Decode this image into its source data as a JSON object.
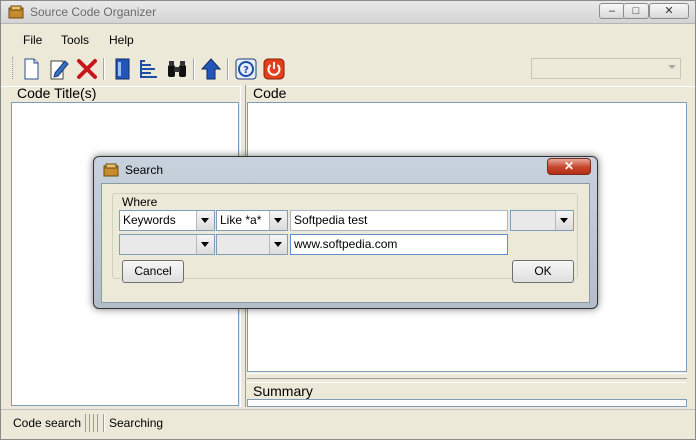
{
  "window": {
    "title": "Source Code Organizer",
    "controls": {
      "minimize": "–",
      "maximize": "□",
      "close": "✕"
    }
  },
  "menu": [
    "File",
    "Tools",
    "Help"
  ],
  "toolbar": {
    "buttons": [
      "new-icon",
      "edit-icon",
      "delete-icon",
      "book-icon",
      "list-icon",
      "binoculars-icon",
      "up-arrow-icon",
      "help-icon",
      "power-icon"
    ]
  },
  "panels": {
    "code_titles_header": "Code Title(s)",
    "code_header": "Code",
    "summary_header": "Summary"
  },
  "status": {
    "left": "Code search",
    "right": "Searching"
  },
  "dialog": {
    "title": "Search",
    "close": "✕",
    "group_label": "Where",
    "row1": {
      "field": "Keywords",
      "operator": "Like *a*",
      "value": "Softpedia test",
      "conjunction": ""
    },
    "row2": {
      "field": "",
      "operator": "",
      "value": "www.softpedia.com"
    },
    "cancel_label": "Cancel",
    "ok_label": "OK"
  },
  "colors": {
    "close_button": "#c7452c",
    "input_border": "#7f9db9"
  }
}
